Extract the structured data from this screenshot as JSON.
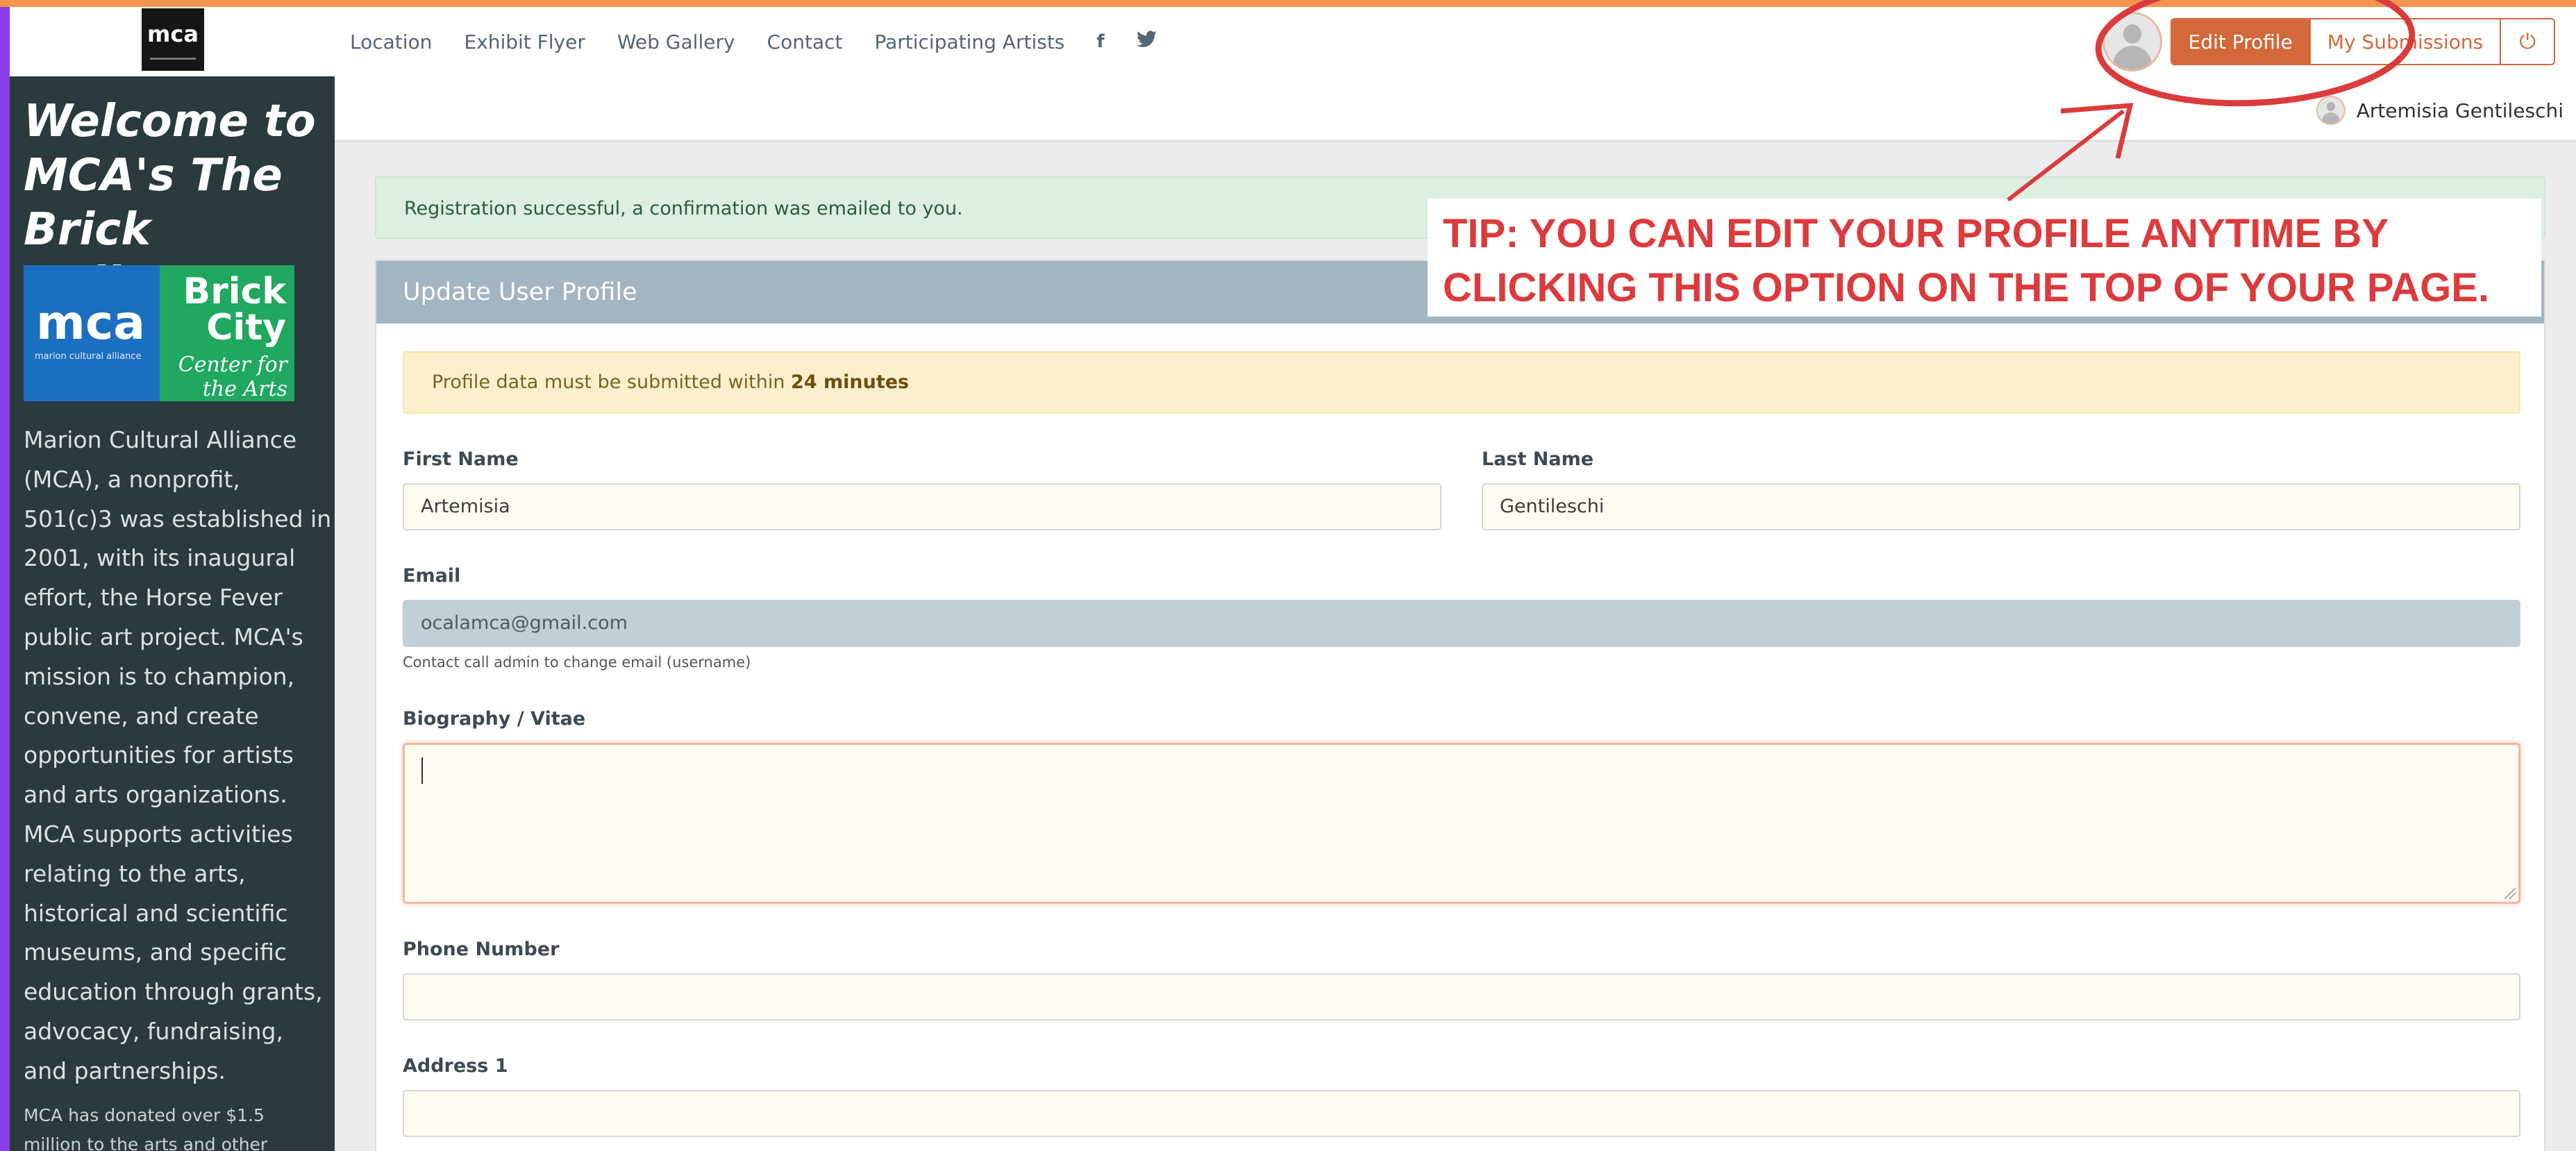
{
  "navbar": {
    "logo_text": "mca",
    "links": [
      "Location",
      "Exhibit Flyer",
      "Web Gallery",
      "Contact",
      "Participating Artists"
    ],
    "social_icons": [
      "facebook-icon",
      "twitter-icon"
    ],
    "facebook_glyph": "f",
    "twitter_glyph": "🐦",
    "edit_profile_label": "Edit Profile",
    "my_submissions_label": "My Submissions",
    "power_glyph": "⏻"
  },
  "sidebar": {
    "title": "Welcome to MCA's The Brick Gallery!",
    "mca_logo_text": "mca",
    "mca_logo_sub": "marion cultural alliance",
    "brick_logo_text": "Brick City",
    "brick_logo_sub": "Center for the Arts",
    "paragraph": "Marion Cultural Alliance (MCA), a nonprofit, 501(c)3 was established in 2001, with its inaugural effort, the Horse Fever public art project. MCA's mission is to champion, convene, and create opportunities for artists and arts organizations. MCA supports activities relating to the arts, historical and scientific museums, and specific education through grants, advocacy, fundraising, and partnerships.",
    "paragraph2": "MCA has donated over $1.5 million to the arts and other"
  },
  "user": {
    "name": "Artemisia Gentileschi"
  },
  "alerts": {
    "success": "Registration successful, a confirmation was emailed to you.",
    "warning_prefix": "Profile data must be submitted within ",
    "warning_bold": "24 minutes"
  },
  "form": {
    "header": "Update User Profile",
    "first_name": {
      "label": "First Name",
      "value": "Artemisia"
    },
    "last_name": {
      "label": "Last Name",
      "value": "Gentileschi"
    },
    "email": {
      "label": "Email",
      "value": "ocalamca@gmail.com",
      "help": "Contact call admin to change email (username)"
    },
    "biography": {
      "label": "Biography / Vitae",
      "value": ""
    },
    "phone": {
      "label": "Phone Number",
      "value": ""
    },
    "address1": {
      "label": "Address 1",
      "value": ""
    }
  },
  "tip": {
    "line1": "TIP: YOU CAN EDIT YOUR PROFILE ANYTIME BY",
    "line2": "CLICKING THIS OPTION ON THE TOP OF YOUR PAGE.",
    "color": "#dc3b3d"
  },
  "colors": {
    "accent": "#d4683a",
    "sidebar_bg": "#2b3a3c",
    "panel_header": "#a2b5c1",
    "top_accent": "#f5944c"
  }
}
